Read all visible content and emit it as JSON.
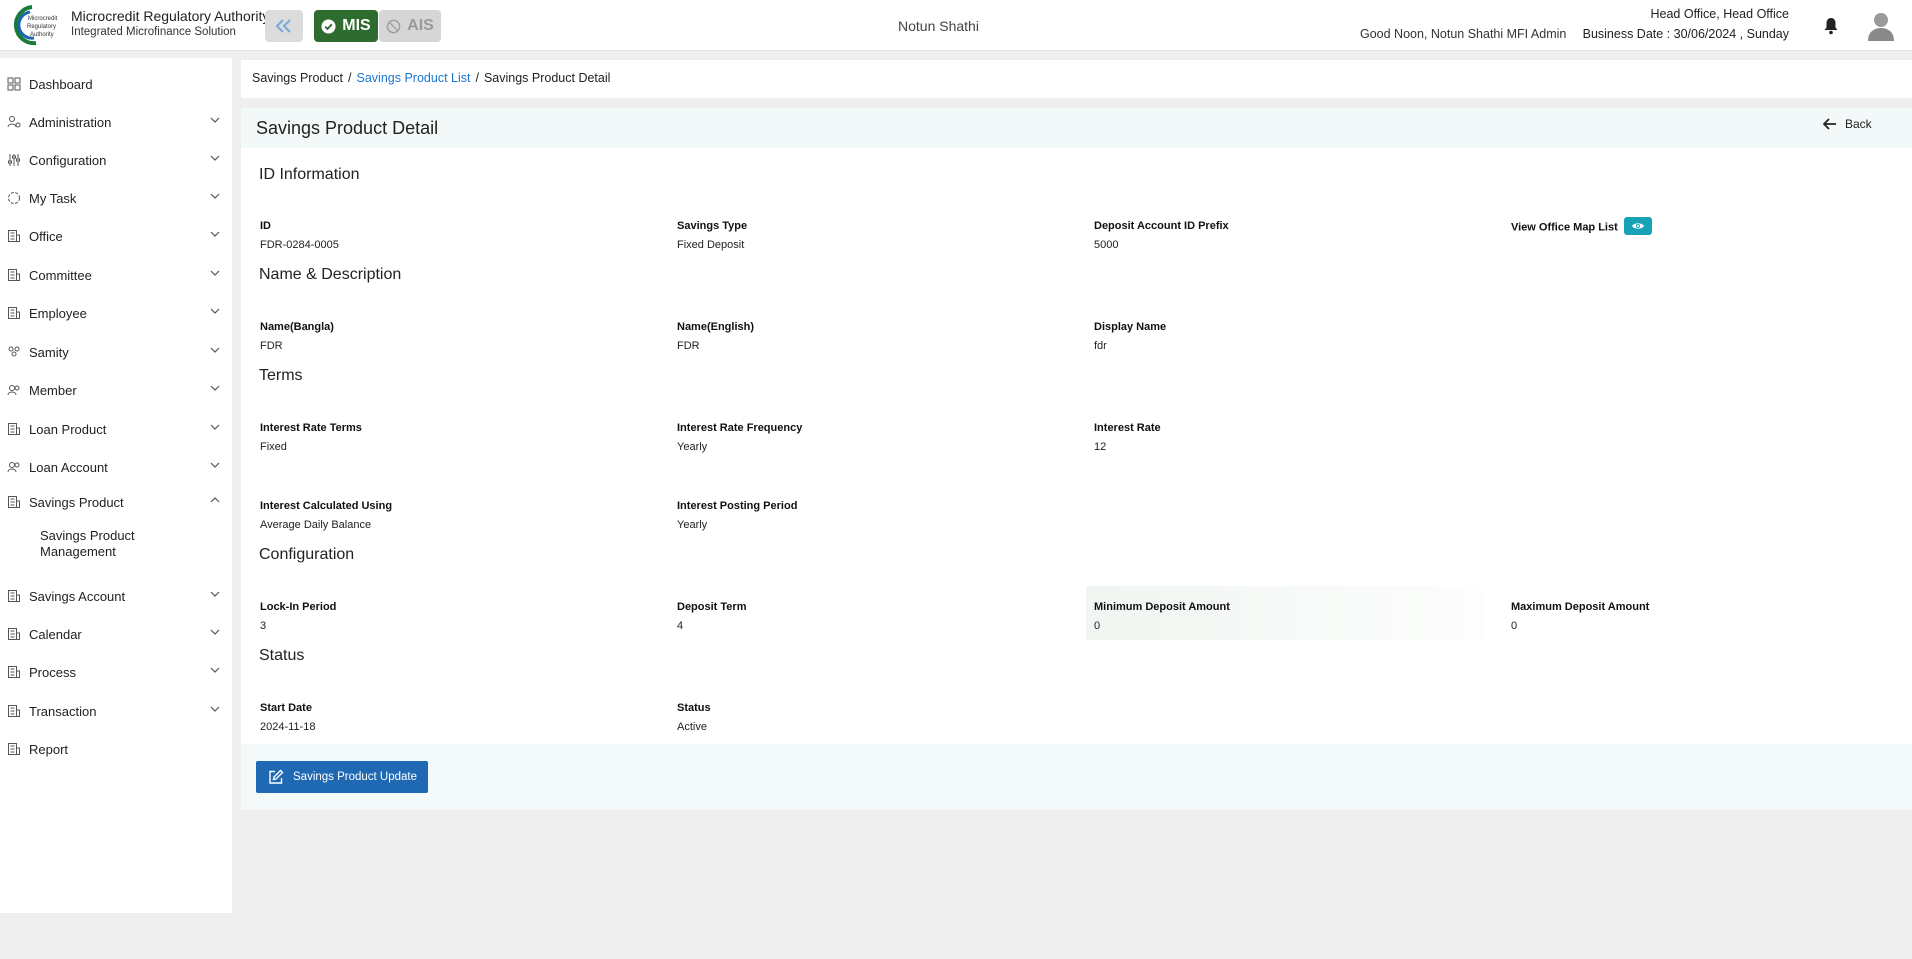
{
  "header": {
    "org_name": "Microcredit Regulatory Authority",
    "org_sub": "Integrated Microfinance Solution",
    "mis_label": "MIS",
    "ais_label": "AIS",
    "center_name": "Notun Shathi",
    "greeting": "Good Noon, Notun Shathi MFI Admin",
    "office": "Head Office, Head Office",
    "business_date": "Business Date : 30/06/2024 , Sunday"
  },
  "sidebar": {
    "items": [
      {
        "label": "Dashboard"
      },
      {
        "label": "Administration"
      },
      {
        "label": "Configuration"
      },
      {
        "label": "My Task"
      },
      {
        "label": "Office"
      },
      {
        "label": "Committee"
      },
      {
        "label": "Employee"
      },
      {
        "label": "Samity"
      },
      {
        "label": "Member"
      },
      {
        "label": "Loan Product"
      },
      {
        "label": "Loan Account"
      },
      {
        "label": "Savings Product"
      },
      {
        "label": "Savings Account"
      },
      {
        "label": "Calendar"
      },
      {
        "label": "Process"
      },
      {
        "label": "Transaction"
      },
      {
        "label": "Report"
      }
    ],
    "sub_item": "Savings Product Management"
  },
  "breadcrumb": {
    "root": "Savings Product",
    "link": "Savings Product List",
    "current": "Savings Product Detail",
    "separator": "/"
  },
  "page": {
    "title": "Savings Product Detail",
    "back_label": "Back",
    "update_label": "Savings Product Update"
  },
  "sections": {
    "id_info": "ID Information",
    "name_desc": "Name & Description",
    "terms": "Terms",
    "configuration": "Configuration",
    "status": "Status"
  },
  "fields": {
    "id": {
      "label": "ID",
      "value": "FDR-0284-0005"
    },
    "savings_type": {
      "label": "Savings Type",
      "value": "Fixed Deposit"
    },
    "deposit_prefix": {
      "label": "Deposit Account ID Prefix",
      "value": "5000"
    },
    "office_map": {
      "label": "View Office Map List"
    },
    "name_bangla": {
      "label": "Name(Bangla)",
      "value": "FDR"
    },
    "name_english": {
      "label": "Name(English)",
      "value": "FDR"
    },
    "display_name": {
      "label": "Display Name",
      "value": "fdr"
    },
    "rate_terms": {
      "label": "Interest Rate Terms",
      "value": "Fixed"
    },
    "rate_freq": {
      "label": "Interest Rate Frequency",
      "value": "Yearly"
    },
    "rate": {
      "label": "Interest Rate",
      "value": "12"
    },
    "calc_using": {
      "label": "Interest Calculated Using",
      "value": "Average Daily Balance"
    },
    "posting_period": {
      "label": "Interest Posting Period",
      "value": "Yearly"
    },
    "lock_in": {
      "label": "Lock-In Period",
      "value": "3"
    },
    "deposit_term": {
      "label": "Deposit Term",
      "value": "4"
    },
    "min_deposit": {
      "label": "Minimum Deposit Amount",
      "value": "0"
    },
    "max_deposit": {
      "label": "Maximum Deposit Amount",
      "value": "0"
    },
    "start_date": {
      "label": "Start Date",
      "value": "2024-11-18"
    },
    "status": {
      "label": "Status",
      "value": "Active"
    }
  },
  "colors": {
    "mis": "#2e6b2e",
    "link": "#1976d2",
    "primary_button": "#1f68b3",
    "eye_button": "#17a2b8"
  }
}
